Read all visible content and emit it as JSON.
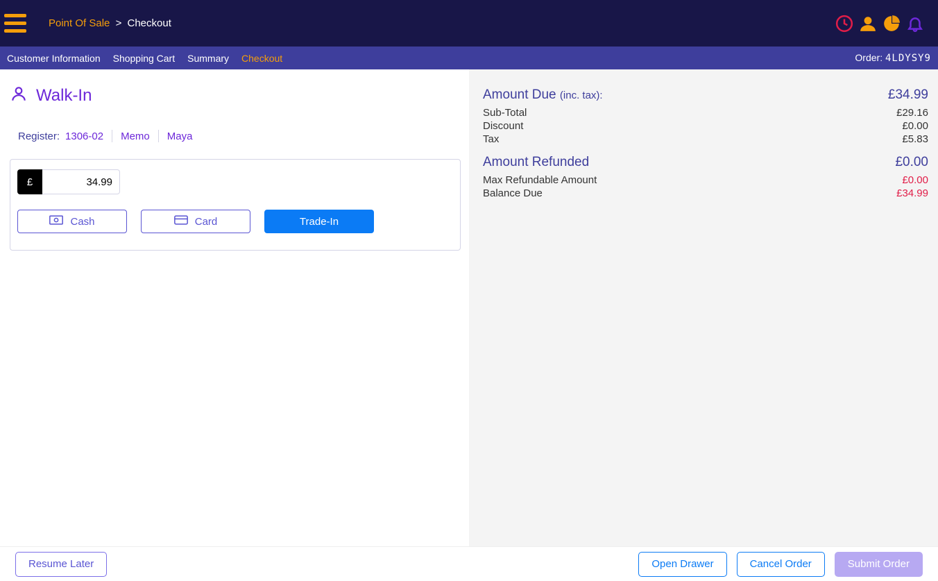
{
  "breadcrumb": {
    "seg1": "Point Of Sale",
    "sep": ">",
    "seg2": "Checkout"
  },
  "tabs": {
    "customer_info": "Customer Information",
    "shopping_cart": "Shopping Cart",
    "summary": "Summary",
    "checkout": "Checkout"
  },
  "order": {
    "label": "Order: ",
    "code": "4LDYSY9"
  },
  "customer": {
    "name": "Walk-In"
  },
  "meta": {
    "register_label": "Register:",
    "register_value": "1306-02",
    "memo_label": "Memo",
    "user": "Maya"
  },
  "payment": {
    "currency_symbol": "£",
    "amount_value": "34.99",
    "cash_label": "Cash",
    "card_label": "Card",
    "tradein_label": "Trade-In"
  },
  "summary": {
    "amount_due_label": "Amount Due ",
    "amount_due_suffix": "(inc. tax):",
    "amount_due_value": "£34.99",
    "subtotal_label": "Sub-Total",
    "subtotal_value": "£29.16",
    "discount_label": "Discount",
    "discount_value": "£0.00",
    "tax_label": "Tax",
    "tax_value": "£5.83",
    "refunded_label": "Amount Refunded",
    "refunded_value": "£0.00",
    "max_refundable_label": "Max Refundable Amount",
    "max_refundable_value": "£0.00",
    "balance_due_label": "Balance Due",
    "balance_due_value": "£34.99"
  },
  "footer": {
    "resume_later": "Resume Later",
    "open_drawer": "Open Drawer",
    "cancel_order": "Cancel Order",
    "submit_order": "Submit Order"
  },
  "icons": {
    "hamburger": "hamburger-icon",
    "clock": "clock-icon",
    "user": "user-icon",
    "chart": "pie-chart-icon",
    "bell": "bell-icon",
    "person": "person-icon",
    "cash": "cash-icon",
    "card": "card-icon"
  }
}
